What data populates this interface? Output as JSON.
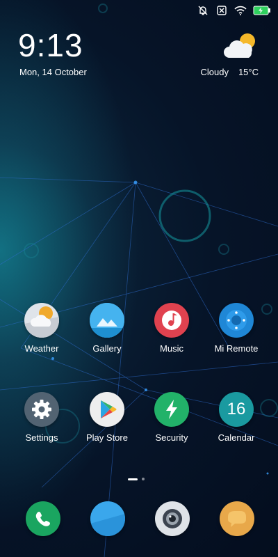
{
  "status_bar": {
    "icons": [
      "alarm-off-icon",
      "notification-icon",
      "wifi-icon",
      "battery-charging-icon"
    ]
  },
  "lockscreen": {
    "time": "9:13",
    "date": "Mon, 14 October",
    "weather_condition": "Cloudy",
    "temperature": "15°C",
    "weather_icon": "cloud-sun-icon"
  },
  "home_apps": [
    {
      "label": "Weather",
      "icon": "weather-icon",
      "color": "#e0e4ea"
    },
    {
      "label": "Gallery",
      "icon": "gallery-icon",
      "color": "#2ea7e8"
    },
    {
      "label": "Music",
      "icon": "music-icon",
      "color": "#e0424f"
    },
    {
      "label": "Mi Remote",
      "icon": "remote-icon",
      "color": "#1e8ad8"
    },
    {
      "label": "Settings",
      "icon": "gear-icon",
      "color": "#556675"
    },
    {
      "label": "Play Store",
      "icon": "play-store-icon",
      "color": "#eeeeee"
    },
    {
      "label": "Security",
      "icon": "security-icon",
      "color": "#23b36a"
    },
    {
      "label": "Calendar",
      "icon": "calendar-icon",
      "color": "#1a9aa0",
      "number": "16"
    }
  ],
  "page_indicator": {
    "current": 1,
    "total": 2
  },
  "dock": [
    {
      "icon": "phone-icon",
      "color": "#1aa560"
    },
    {
      "icon": "messaging-icon",
      "color": "#2c98dd"
    },
    {
      "icon": "camera-icon",
      "color": "#dfe3e8"
    },
    {
      "icon": "chat-icon",
      "color": "#e8a84a"
    }
  ]
}
